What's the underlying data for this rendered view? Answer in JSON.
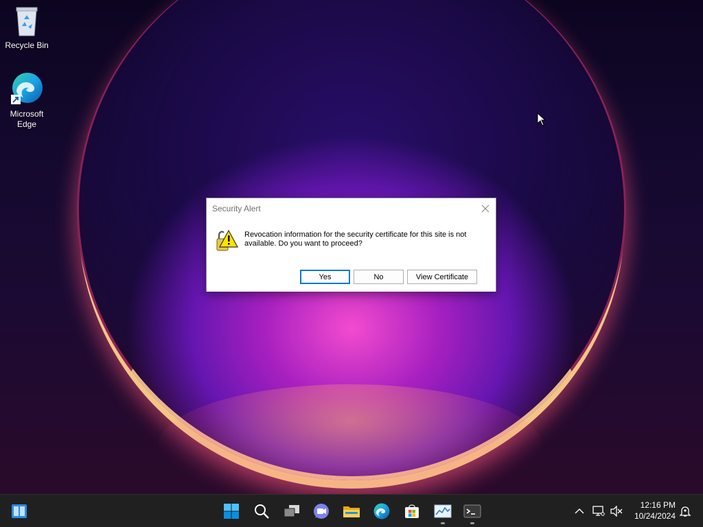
{
  "desktop": {
    "icons": [
      {
        "label": "Recycle Bin",
        "icon": "recycle-bin-icon"
      },
      {
        "label": "Microsoft Edge",
        "label_lines": [
          "Microsoft",
          "Edge"
        ],
        "icon": "edge-icon"
      }
    ]
  },
  "dialog": {
    "title": "Security Alert",
    "message": "Revocation information for the security certificate for this site is not available. Do you want to proceed?",
    "buttons": {
      "yes": "Yes",
      "no": "No",
      "view": "View Certificate"
    },
    "icon": "security-alert-lock-icon"
  },
  "taskbar": {
    "left_icon": "widgets-icon",
    "pinned": [
      "start-icon",
      "search-icon",
      "task-view-icon",
      "chat-icon",
      "file-explorer-icon",
      "edge-icon",
      "store-icon",
      "task-manager-icon",
      "terminal-icon"
    ],
    "tray": {
      "icons": [
        "chevron-up-icon",
        "network-icon",
        "volume-muted-icon",
        "notification-icon"
      ]
    },
    "clock": {
      "time": "12:16 PM",
      "date": "10/24/2024"
    }
  },
  "colors": {
    "accent": "#0078d7",
    "taskbar": "#202020"
  }
}
